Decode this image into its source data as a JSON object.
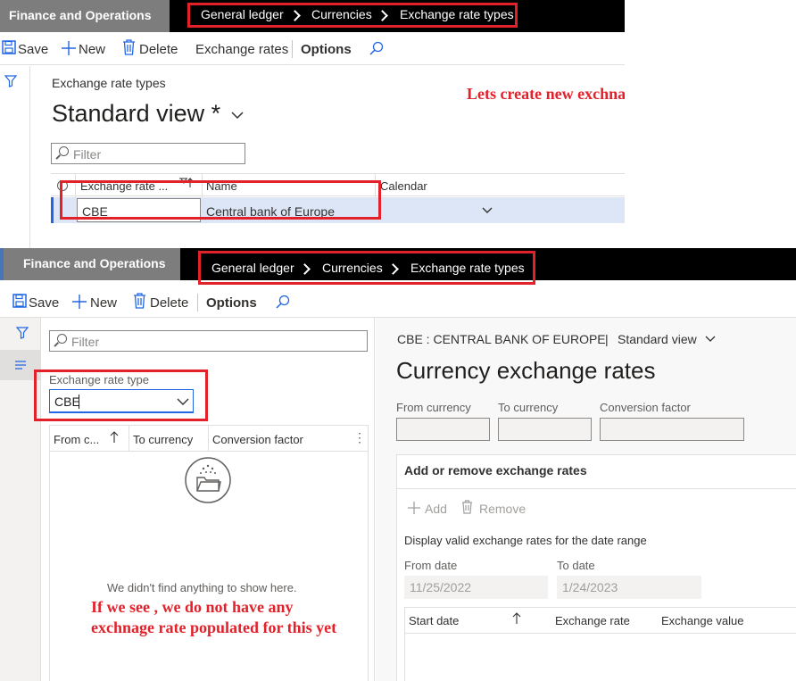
{
  "top": {
    "app_title": "Finance and Operations",
    "breadcrumb": [
      "General ledger",
      "Currencies",
      "Exchange rate types"
    ],
    "actions": {
      "save": "Save",
      "new": "New",
      "delete": "Delete",
      "exchange_rates": "Exchange rates",
      "options": "Options"
    },
    "page_caption": "Exchange rate types",
    "view_title": "Standard view *",
    "filter_placeholder": "Filter",
    "grid": {
      "columns": [
        "Exchange rate ...",
        "Name",
        "Calendar"
      ],
      "row": {
        "code": "CBE",
        "name": "Central bank of Europe",
        "calendar": ""
      }
    },
    "annotation": "Lets create new exchnage rate type"
  },
  "bottom": {
    "app_title": "Finance and Operations",
    "breadcrumb": [
      "General ledger",
      "Currencies",
      "Exchange rate types"
    ],
    "actions": {
      "save": "Save",
      "new": "New",
      "delete": "Delete",
      "options": "Options"
    },
    "filter_placeholder": "Filter",
    "exchange_rate_type_label": "Exchange rate type",
    "exchange_rate_type_value": "CBE",
    "list_columns": [
      "From c...",
      "To currency",
      "Conversion factor"
    ],
    "empty_message": "We didn't find anything to show here.",
    "annotation": "If we see , we do not have any exchnage rate populated for this yet",
    "detail": {
      "caption": "CBE : CENTRAL BANK OF EUROPE",
      "separator": "|",
      "view": "Standard view",
      "title": "Currency exchange rates",
      "fields": [
        "From currency",
        "To currency",
        "Conversion factor"
      ],
      "section_title": "Add or remove exchange rates",
      "add": "Add",
      "remove": "Remove",
      "range_caption": "Display valid exchange rates for the date range",
      "from_date_label": "From date",
      "from_date": "11/25/2022",
      "to_date_label": "To date",
      "to_date": "1/24/2023",
      "rates_columns": [
        "Start date",
        "Exchange rate",
        "Exchange value"
      ]
    }
  },
  "colors": {
    "annotation_red": "#e3212b",
    "selected_row": "#dde6f7",
    "accent": "#2266e3"
  }
}
